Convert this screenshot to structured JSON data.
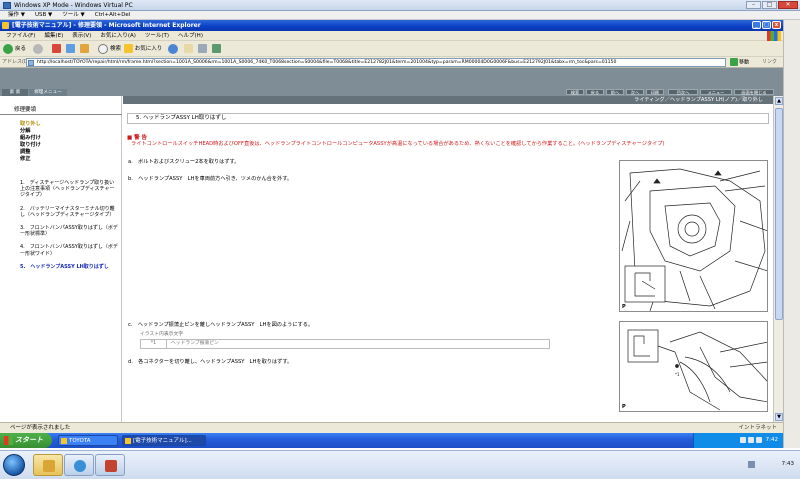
{
  "vpc": {
    "title": "Windows XP Mode - Windows Virtual PC",
    "menu": [
      "操作 ▼",
      "USB ▼",
      "ツール ▼",
      "Ctrl+Alt+Del"
    ]
  },
  "ie": {
    "title": "[電子技術マニュアル] - 修理要領 - Microsoft Internet Explorer",
    "menu": [
      "ファイル(F)",
      "編集(E)",
      "表示(V)",
      "お気に入り(A)",
      "ツール(T)",
      "ヘルプ(H)"
    ],
    "toolbar": {
      "back": "戻る",
      "search": "検索",
      "favorites": "お気に入り"
    },
    "address_label": "アドレス(D)",
    "address_url": "http://localhost/TOYOTA/repair/html/rm/frame.html?section=1001A_S0006&rm=1001A_S0006_74K0_T0068section=S0004&file=T0068&title=E212782J01&term=201004&typ=param=RM00004D0G0006F&bus=E212792J01&tabx=rm_toc&pars=01150",
    "go": "移動",
    "links": "リンク",
    "status": "ページが表示されました",
    "status_zone": "イントラネット"
  },
  "page": {
    "tabs": [
      "索 索",
      "修理メニュー"
    ],
    "right_buttons": [
      "検索",
      "戻る",
      "前へ",
      "次へ",
      "印刷",
      "目次へ",
      "メニュー",
      "画面を閉じる"
    ],
    "sidebar_heading": "修理要領",
    "sidebar_links": [
      "取り外し",
      "分解",
      "組み付け",
      "取り付け",
      "調整",
      "修正"
    ],
    "sidebar_steps": [
      "1.　ディスチャージヘッドランプ取り扱い上の注意事項（ヘッドランプディスチャージタイプ）",
      "2.　バッテリーマイナスターミナル切り離し（ヘッドランプディスチャージタイプ）",
      "3.　フロントバンパASSY取りはずし（ボデー形状標準）",
      "4.　フロントバンパASSY取りはずし（ボデー形状ワイド）",
      "5.　ヘッドランプASSY LH取りはずし"
    ],
    "breadcrumb": "ライティング／ヘッドランプASSY LH(ノア)／取り外し",
    "section_title": "5.  ヘッドランプASSY LH取りはずし",
    "caution_heading": "■ 警 告",
    "caution_text": "ライトコントロールスイッチHEAD時およびOFF直後は、ヘッドランプライトコントロールコンピュータASSYが高温になっている場合があるため、熱くないことを確認してから作業すること。(ヘッドランプディスチャージタイプ)",
    "step_a": "a.　ボルトおよびスクリュー2本を取りはずす。",
    "step_b": "b.　ヘッドランプASSY　LHを車両前方へ引き、ツメのかん合を外す。",
    "step_c": "c.　ヘッドランプ振蕩止ピンを離しヘッドランプASSY　LHを図のようにする。",
    "illus_head": "イラスト内表示文字",
    "illus_num": "*1",
    "illus_text": "ヘッドランプ振蕩ピン",
    "step_d": "d.　各コネクターを切り離し、ヘッドランプASSY　LHを取りはずす。",
    "fig_label": "P"
  },
  "xp_taskbar": {
    "start": "スタート",
    "tasks": [
      "TOYOTA",
      "[電子技術マニュアル]..."
    ],
    "time": "7:42"
  },
  "host_taskbar": {
    "time": "7:43"
  }
}
